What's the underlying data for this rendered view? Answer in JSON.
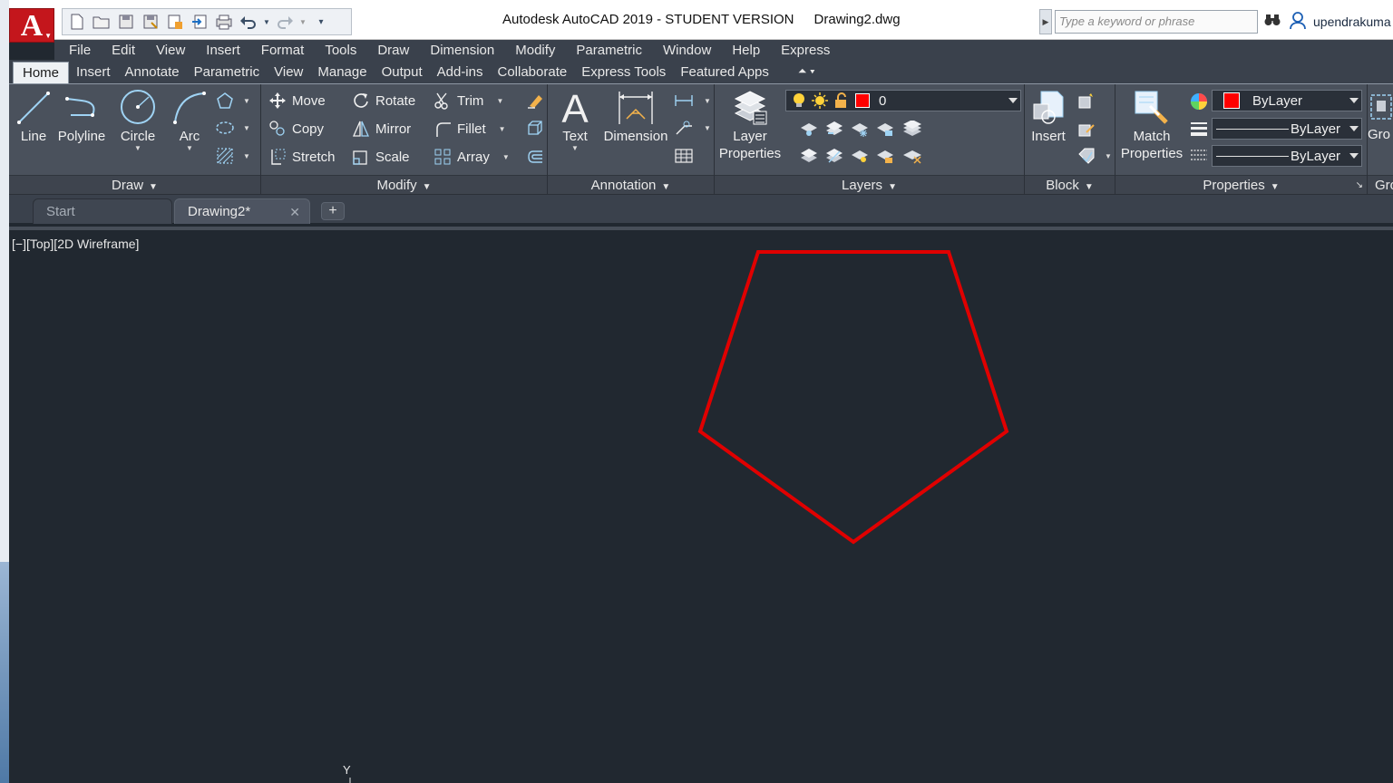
{
  "window": {
    "title": "Autodesk AutoCAD 2019 - STUDENT VERSION",
    "filename": "Drawing2.dwg",
    "logo_letter": "A"
  },
  "search": {
    "placeholder": "Type a keyword or phrase"
  },
  "user": {
    "name": "upendrakuma"
  },
  "menu": [
    "File",
    "Edit",
    "View",
    "Insert",
    "Format",
    "Tools",
    "Draw",
    "Dimension",
    "Modify",
    "Parametric",
    "Window",
    "Help",
    "Express"
  ],
  "ribbon_tabs": [
    "Home",
    "Insert",
    "Annotate",
    "Parametric",
    "View",
    "Manage",
    "Output",
    "Add-ins",
    "Collaborate",
    "Express Tools",
    "Featured Apps"
  ],
  "active_ribbon_tab": "Home",
  "panels": {
    "draw": {
      "title": "Draw",
      "line": "Line",
      "polyline": "Polyline",
      "circle": "Circle",
      "arc": "Arc"
    },
    "modify": {
      "title": "Modify",
      "move": "Move",
      "rotate": "Rotate",
      "trim": "Trim",
      "copy": "Copy",
      "mirror": "Mirror",
      "fillet": "Fillet",
      "stretch": "Stretch",
      "scale": "Scale",
      "array": "Array"
    },
    "annotation": {
      "title": "Annotation",
      "text": "Text",
      "dimension": "Dimension"
    },
    "layers": {
      "title": "Layers",
      "layer_properties_1": "Layer",
      "layer_properties_2": "Properties",
      "current_layer": "0"
    },
    "block": {
      "title": "Block",
      "insert": "Insert"
    },
    "properties": {
      "title": "Properties",
      "match_1": "Match",
      "match_2": "Properties",
      "color": "ByLayer",
      "lineweight": "ByLayer",
      "linetype": "ByLayer"
    },
    "groups": {
      "label": "Gro",
      "title": "Gro"
    }
  },
  "doc_tabs": {
    "start": "Start",
    "drawing": "Drawing2*",
    "close": "✕",
    "new": "+"
  },
  "viewport": {
    "label": "[−][Top][2D Wireframe]"
  },
  "ucs": {
    "y_label": "Y"
  },
  "colors": {
    "pentagon": "#e00000",
    "canvas_bg": "#212830",
    "accent_red": "#c4161c"
  }
}
